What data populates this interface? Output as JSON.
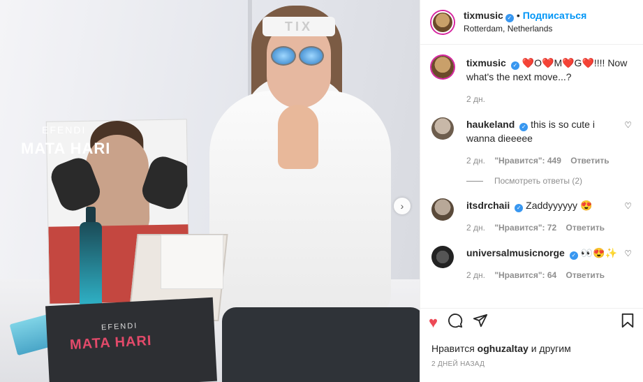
{
  "post": {
    "username": "tixmusic",
    "follow_label": "Подписаться",
    "location": "Rotterdam, Netherlands",
    "caption": {
      "username": "tixmusic",
      "text": "❤️O❤️M❤️G❤️!!!! Now what's the next move...?",
      "time": "2 дн."
    }
  },
  "photo": {
    "headband_text": "TIX",
    "poster_brand": "EFENDI",
    "poster_title": "MATA HARI",
    "bag_brand": "EFENDI",
    "bag_title": "MATA HARI",
    "next_glyph": "›"
  },
  "comments": [
    {
      "username": "haukeland",
      "text": "this is so cute i wanna dieeeee",
      "time": "2 дн.",
      "likes": "\"Нравится\": 449",
      "reply": "Ответить",
      "view_replies": "Посмотреть ответы (2)"
    },
    {
      "username": "itsdrchaii",
      "text": "Zaddyyyyyy 😍",
      "time": "2 дн.",
      "likes": "\"Нравится\": 72",
      "reply": "Ответить"
    },
    {
      "username": "universalmusicnorge",
      "text": "👀😍✨",
      "time": "2 дн.",
      "likes": "\"Нравится\": 64",
      "reply": "Ответить"
    }
  ],
  "footer": {
    "liked_prefix": "Нравится",
    "liked_user": "oghuzaltay",
    "liked_suffix": "и другим",
    "date": "2 ДНЕЙ НАЗАД"
  },
  "icons": {
    "like": "heart-icon",
    "comment": "comment-icon",
    "share": "share-icon",
    "save": "bookmark-icon"
  },
  "colors": {
    "accent": "#0095f6",
    "like": "#ed4956",
    "verified": "#3897f0"
  }
}
